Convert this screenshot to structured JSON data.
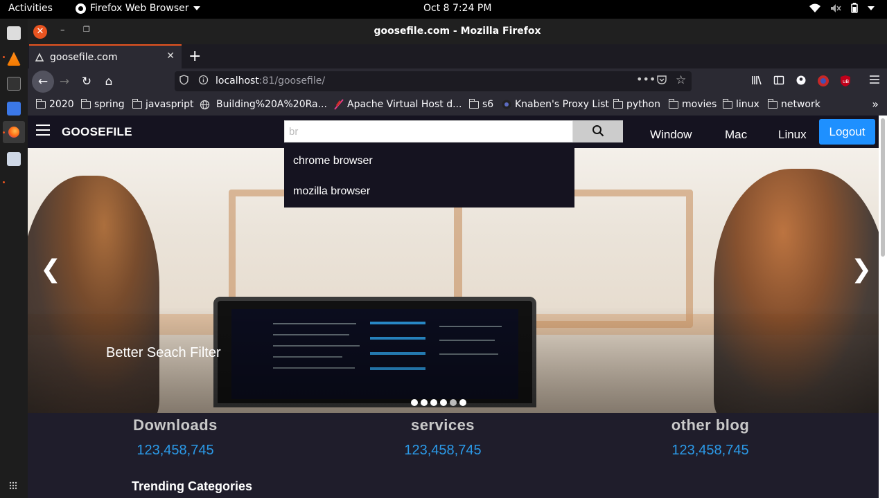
{
  "topbar": {
    "activities": "Activities",
    "app_name": "Firefox Web Browser",
    "clock": "Oct 8  7:24 PM"
  },
  "window": {
    "title": "goosefile.com - Mozilla Firefox"
  },
  "tabs": [
    {
      "label": "goosefile.com"
    }
  ],
  "urlbar": {
    "host": "localhost",
    "rest": ":81/goosefile/"
  },
  "bookmarks": [
    {
      "label": "2020",
      "icon": "folder-icon"
    },
    {
      "label": "spring",
      "icon": "folder-icon"
    },
    {
      "label": "javaspript",
      "icon": "folder-icon"
    },
    {
      "label": "Building%20A%20Ra...",
      "icon": "globe-icon"
    },
    {
      "label": "Apache Virtual Host d...",
      "icon": "feather-icon"
    },
    {
      "label": "s6",
      "icon": "folder-icon"
    },
    {
      "label": "Knaben's Proxy List",
      "icon": "site-icon"
    },
    {
      "label": "python",
      "icon": "folder-icon"
    },
    {
      "label": "movies",
      "icon": "folder-icon"
    },
    {
      "label": "linux",
      "icon": "folder-icon"
    },
    {
      "label": "network",
      "icon": "folder-icon"
    }
  ],
  "site": {
    "brand": "GOOSEFILE",
    "search": {
      "value": "br"
    },
    "nav_links": [
      "Window",
      "Mac",
      "Linux"
    ],
    "logout": "Logout",
    "suggestions": [
      "chrome browser",
      "mozilla browser"
    ],
    "hero": {
      "caption": "Better Seach Filter",
      "prev": "❮",
      "next": "❯",
      "slides": 6,
      "active_slide": 5
    },
    "stats": [
      {
        "label": "Downloads",
        "value": "123,458,745"
      },
      {
        "label": "services",
        "value": "123,458,745"
      },
      {
        "label": "other blog",
        "value": "123,458,745"
      }
    ],
    "trending_title": "Trending Categories"
  },
  "colors": {
    "accent": "#e95420",
    "logout_bg": "#1e90ff",
    "stat_number": "#2b9ae8"
  }
}
